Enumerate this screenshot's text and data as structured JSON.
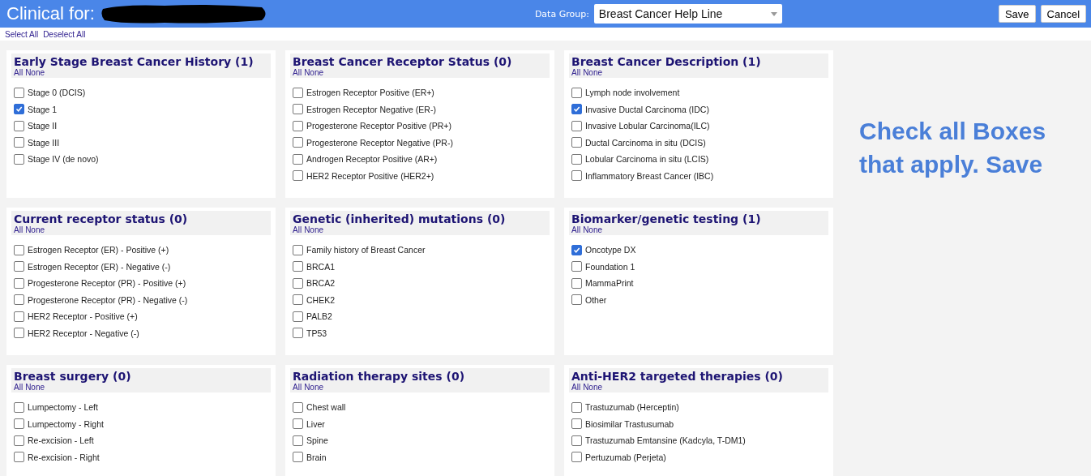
{
  "header": {
    "title": "Clinical for:",
    "redacted": true,
    "data_group_label": "Data Group:",
    "data_group_value": "Breast Cancer Help Line",
    "buttons": [
      "Save",
      "Cancel"
    ]
  },
  "bulk_links": [
    "Select All",
    "Deselect All"
  ],
  "note": "Check all Boxes that apply. Save",
  "panels": [
    {
      "title": "Early Stage Breast Cancer History (1)",
      "links": [
        "All",
        "None"
      ],
      "items": [
        {
          "label": "Stage 0 (DCIS)",
          "checked": false
        },
        {
          "label": "Stage 1",
          "checked": true
        },
        {
          "label": "Stage II",
          "checked": false
        },
        {
          "label": "Stage III",
          "checked": false
        },
        {
          "label": "Stage IV (de novo)",
          "checked": false
        }
      ]
    },
    {
      "title": "Breast Cancer Receptor Status (0)",
      "links": [
        "All",
        "None"
      ],
      "items": [
        {
          "label": "Estrogen Receptor Positive (ER+)",
          "checked": false
        },
        {
          "label": "Estrogen Receptor Negative (ER-)",
          "checked": false
        },
        {
          "label": "Progesterone Receptor Positive (PR+)",
          "checked": false
        },
        {
          "label": "Progesterone Receptor Negative (PR-)",
          "checked": false
        },
        {
          "label": "Androgen Receptor Positive (AR+)",
          "checked": false
        },
        {
          "label": "HER2 Receptor Positive (HER2+)",
          "checked": false
        }
      ]
    },
    {
      "title": "Breast Cancer Description (1)",
      "links": [
        "All",
        "None"
      ],
      "items": [
        {
          "label": "Lymph node involvement",
          "checked": false
        },
        {
          "label": "Invasive Ductal Carcinoma (IDC)",
          "checked": true
        },
        {
          "label": "Invasive Lobular Carcinoma(ILC)",
          "checked": false
        },
        {
          "label": "Ductal Carcinoma in situ (DCIS)",
          "checked": false
        },
        {
          "label": "Lobular Carcinoma in situ (LCIS)",
          "checked": false
        },
        {
          "label": "Inflammatory Breast Cancer (IBC)",
          "checked": false
        }
      ]
    },
    {
      "title": "Current receptor status (0)",
      "links": [
        "All",
        "None"
      ],
      "items": [
        {
          "label": "Estrogen Receptor (ER) - Positive (+)",
          "checked": false
        },
        {
          "label": "Estrogen Receptor (ER) - Negative (-)",
          "checked": false
        },
        {
          "label": "Progesterone Receptor (PR) - Positive (+)",
          "checked": false
        },
        {
          "label": "Progesterone Receptor (PR) - Negative (-)",
          "checked": false
        },
        {
          "label": "HER2 Receptor - Positive (+)",
          "checked": false
        },
        {
          "label": "HER2 Receptor - Negative (-)",
          "checked": false
        }
      ]
    },
    {
      "title": "Genetic (inherited) mutations (0)",
      "links": [
        "All",
        "None"
      ],
      "items": [
        {
          "label": "Family history of Breast Cancer",
          "checked": false
        },
        {
          "label": "BRCA1",
          "checked": false
        },
        {
          "label": "BRCA2",
          "checked": false
        },
        {
          "label": "CHEK2",
          "checked": false
        },
        {
          "label": "PALB2",
          "checked": false
        },
        {
          "label": "TP53",
          "checked": false
        }
      ]
    },
    {
      "title": "Biomarker/genetic testing (1)",
      "links": [
        "All",
        "None"
      ],
      "items": [
        {
          "label": "Oncotype DX",
          "checked": true
        },
        {
          "label": "Foundation 1",
          "checked": false
        },
        {
          "label": "MammaPrint",
          "checked": false
        },
        {
          "label": "Other",
          "checked": false
        }
      ]
    },
    {
      "title": "Breast surgery (0)",
      "links": [
        "All",
        "None"
      ],
      "items": [
        {
          "label": "Lumpectomy - Left",
          "checked": false
        },
        {
          "label": "Lumpectomy - Right",
          "checked": false
        },
        {
          "label": "Re-excision - Left",
          "checked": false
        },
        {
          "label": "Re-excision - Right",
          "checked": false
        }
      ]
    },
    {
      "title": "Radiation therapy sites (0)",
      "links": [
        "All",
        "None"
      ],
      "items": [
        {
          "label": "Chest wall",
          "checked": false
        },
        {
          "label": "Liver",
          "checked": false
        },
        {
          "label": "Spine",
          "checked": false
        },
        {
          "label": "Brain",
          "checked": false
        }
      ]
    },
    {
      "title": "Anti-HER2 targeted therapies (0)",
      "links": [
        "All",
        "None"
      ],
      "items": [
        {
          "label": "Trastuzumab (Herceptin)",
          "checked": false
        },
        {
          "label": "Biosimilar Trastusumab",
          "checked": false
        },
        {
          "label": "Trastuzumab Emtansine (Kadcyla, T-DM1)",
          "checked": false
        },
        {
          "label": "Pertuzumab (Perjeta)",
          "checked": false
        }
      ]
    }
  ]
}
